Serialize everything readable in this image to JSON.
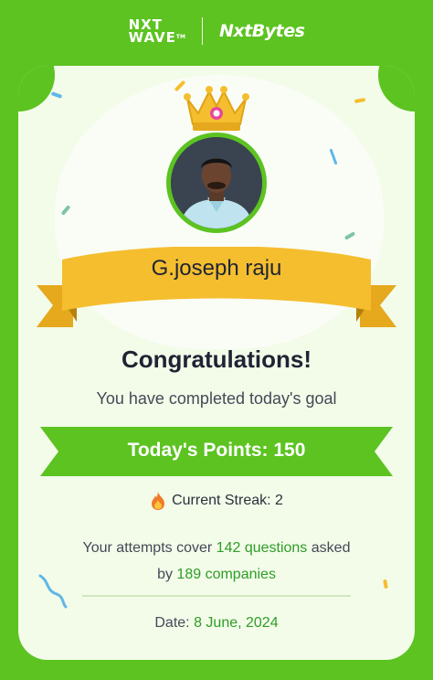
{
  "header": {
    "brand_left": "NXT",
    "brand_left_2": "WAVE",
    "brand_tm": "TM",
    "brand_right": "NxtBytes"
  },
  "card": {
    "name": "G.joseph raju",
    "title": "Congratulations!",
    "subtitle": "You have completed today's goal",
    "points_label": "Today's Points: 150",
    "streak_label": "Current Streak: 2",
    "attempts_prefix": "Your attempts cover",
    "questions_count": "142 questions",
    "attempts_suffix": "asked",
    "by_label": "by",
    "companies_count": "189 companies",
    "date_label": "Date:",
    "date_value": "8 June, 2024"
  },
  "colors": {
    "brand_green": "#5cc321",
    "card_bg": "#f3fbe9",
    "ribbon_yellow": "#f5be2f",
    "highlight": "#2e9e27"
  },
  "icons": [
    "crown-icon",
    "fire-icon",
    "avatar-photo"
  ]
}
